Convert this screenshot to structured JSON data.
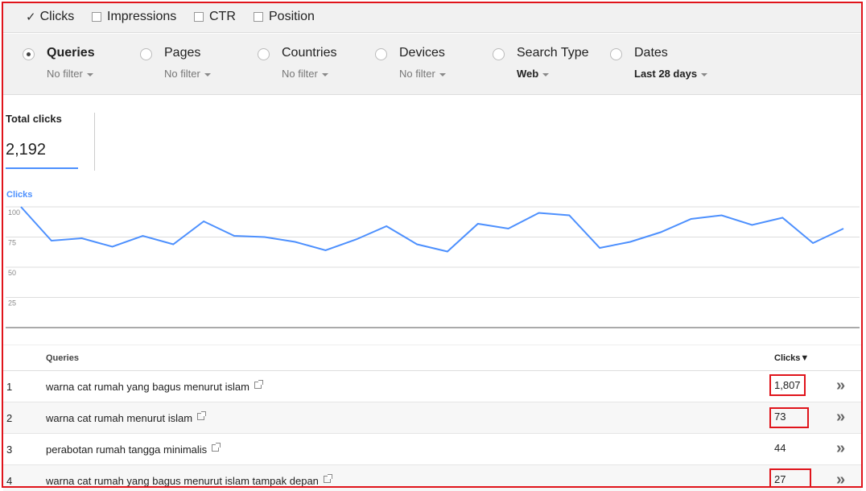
{
  "metrics": [
    {
      "label": "Clicks",
      "checked": true
    },
    {
      "label": "Impressions",
      "checked": false
    },
    {
      "label": "CTR",
      "checked": false
    },
    {
      "label": "Position",
      "checked": false
    }
  ],
  "dimensions": [
    {
      "label": "Queries",
      "filter": "No filter",
      "selected": true
    },
    {
      "label": "Pages",
      "filter": "No filter",
      "selected": false
    },
    {
      "label": "Countries",
      "filter": "No filter",
      "selected": false
    },
    {
      "label": "Devices",
      "filter": "No filter",
      "selected": false
    },
    {
      "label": "Search Type",
      "filter": "Web",
      "selected": false
    },
    {
      "label": "Dates",
      "filter": "Last 28 days",
      "selected": false
    }
  ],
  "total": {
    "label": "Total clicks",
    "value": "2,192"
  },
  "chart_data": {
    "type": "line",
    "series": [
      {
        "name": "Clicks",
        "values": [
          100,
          72,
          74,
          67,
          76,
          69,
          88,
          76,
          75,
          71,
          64,
          73,
          84,
          69,
          63,
          86,
          82,
          95,
          93,
          66,
          71,
          79,
          90,
          93,
          85,
          91,
          70,
          82
        ]
      }
    ],
    "yticks": [
      "100",
      "75",
      "50",
      "25"
    ],
    "ylim": [
      0,
      100
    ],
    "color": "#4d90fe"
  },
  "table": {
    "col_query": "Queries",
    "col_clicks": "Clicks▼",
    "rows": [
      {
        "num": "1",
        "query": "warna cat rumah yang bagus menurut islam",
        "clicks": "1,807"
      },
      {
        "num": "2",
        "query": "warna cat rumah menurut islam",
        "clicks": "73"
      },
      {
        "num": "3",
        "query": "perabotan rumah tangga minimalis",
        "clicks": "44"
      },
      {
        "num": "4",
        "query": "warna cat rumah yang bagus menurut islam tampak depan",
        "clicks": "27"
      }
    ]
  },
  "icons": {
    "check": "✓",
    "expand": "»"
  },
  "accent": "#4d90fe",
  "highlight": "#e0141b"
}
